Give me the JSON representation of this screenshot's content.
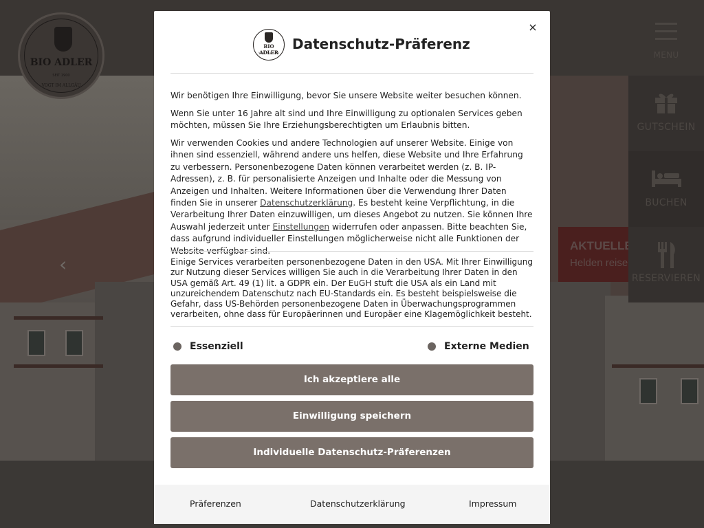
{
  "site": {
    "logo": {
      "name": "BIO ADLER",
      "year": "SEIT 1900",
      "subtitle": "VOGT IM ALLGÄU"
    },
    "side_nav": [
      {
        "label": "MENU",
        "icon": "menu-icon"
      },
      {
        "label": "GUTSCHEIN",
        "icon": "gift-icon"
      },
      {
        "label": "BUCHEN",
        "icon": "bed-icon"
      },
      {
        "label": "RESERVIEREN",
        "icon": "cutlery-icon"
      }
    ],
    "promo": {
      "title": "AKTUELLE",
      "subtitle": "Helden reise"
    }
  },
  "modal": {
    "title": "Datenschutz-Präferenz",
    "close_label": "×",
    "logo": {
      "name": "BIO ADLER",
      "subtitle": "VOGT IM ALLGÄU"
    },
    "p1": "Wir benötigen Ihre Einwilligung, bevor Sie unsere Website weiter besuchen können.",
    "p2": "Wenn Sie unter 16 Jahre alt sind und Ihre Einwilligung zu optionalen Services geben möchten, müssen Sie Ihre Erziehungsberechtigten um Erlaubnis bitten.",
    "p3": {
      "part1": "Wir verwenden Cookies und andere Technologien auf unserer Website. Einige von ihnen sind essenziell, während andere uns helfen, diese Website und Ihre Erfahrung zu verbessern. Personenbezogene Daten können verarbeitet werden (z. B. IP-Adressen), z. B. für personalisierte Anzeigen und Inhalte oder die Messung von Anzeigen und Inhalten. Weitere Informationen über die Verwendung Ihrer Daten finden Sie in unserer ",
      "link1": "Datenschutzerklärung",
      "part2": ". Es besteht keine Verpflichtung, in die Verarbeitung Ihrer Daten einzuwilligen, um dieses Angebot zu nutzen. Sie können Ihre Auswahl jederzeit unter ",
      "link2": "Einstellungen",
      "part3": " widerrufen oder anpassen. Bitte beachten Sie, dass aufgrund individueller Einstellungen möglicherweise nicht alle Funktionen der Website verfügbar sind."
    },
    "p4": "Einige Services verarbeiten personenbezogene Daten in den USA. Mit Ihrer Einwilligung zur Nutzung dieser Services willigen Sie auch in die Verarbeitung Ihrer Daten in den USA gemäß Art. 49 (1) lit. a GDPR ein. Der EuGH stuft die USA als ein Land mit unzureichendem Datenschutz nach EU-Standards ein. Es besteht beispielsweise die Gefahr, dass US-Behörden personenbezogene Daten in Überwachungsprogrammen verarbeiten, ohne dass für Europäerinnen und Europäer eine Klagemöglichkeit besteht.",
    "checkboxes": [
      {
        "label": "Essenziell"
      },
      {
        "label": "Externe Medien"
      }
    ],
    "buttons": {
      "accept_all": "Ich akzeptiere alle",
      "save": "Einwilligung speichern",
      "individual": "Individuelle Datenschutz-Präferenzen"
    },
    "footer": {
      "preferences": "Präferenzen",
      "privacy": "Datenschutzerklärung",
      "imprint": "Impressum"
    }
  },
  "colors": {
    "button_bg": "#7a706a",
    "overlay": "#2a2624",
    "checkbox": "#6b6460"
  }
}
